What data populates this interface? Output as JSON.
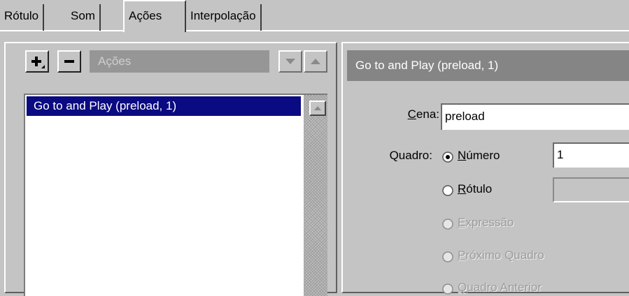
{
  "tabs": [
    {
      "label": "Rótulo"
    },
    {
      "label": "Som"
    },
    {
      "label": "Ações"
    },
    {
      "label": "Interpolação"
    }
  ],
  "actions_panel": {
    "add_label": "+",
    "remove_label": "−",
    "header_label": "Ações",
    "list_items": [
      "Go to and Play (preload, 1)"
    ]
  },
  "parameters": {
    "title": "Go to and Play (preload, 1)",
    "scene_label_first": "C",
    "scene_label_rest": "ena:",
    "scene_value": "preload",
    "frame_label": "Quadro:",
    "options": [
      {
        "first": "N",
        "rest": "úmero",
        "selected": true,
        "enabled": true
      },
      {
        "first": "R",
        "rest": "ótulo",
        "selected": false,
        "enabled": true
      },
      {
        "first": "E",
        "rest": "xpressão",
        "selected": false,
        "enabled": false
      },
      {
        "first": "P",
        "rest": "róximo Quadro",
        "selected": false,
        "enabled": false
      },
      {
        "first": "Q",
        "rest": "uadro Anterior",
        "selected": false,
        "enabled": false
      }
    ],
    "number_value": "1",
    "label_value": ""
  }
}
